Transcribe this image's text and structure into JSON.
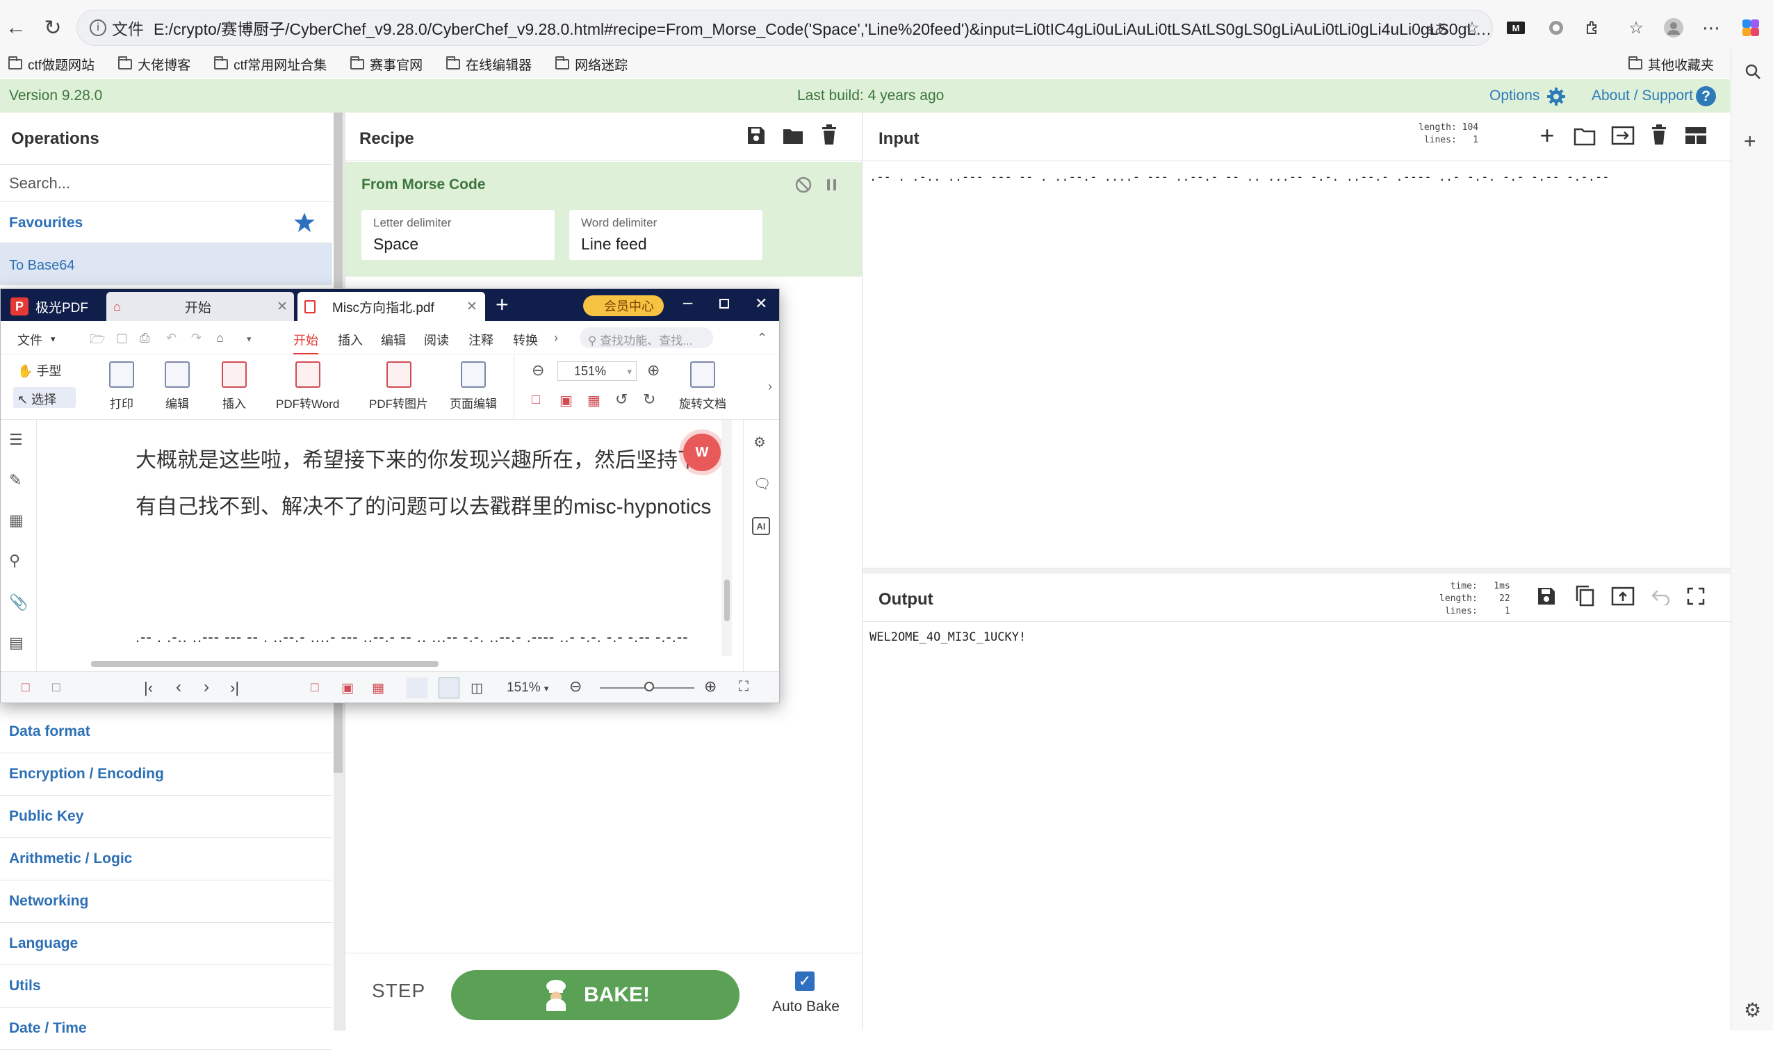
{
  "browser": {
    "file_label": "文件",
    "url": "E:/crypto/赛博厨子/CyberChef_v9.28.0/CyberChef_v9.28.0.html#recipe=From_Morse_Code('Space','Line%20feed')&input=Li0tIC4gLi0uLiAuLi0tLSAtLS0gLS0gLiAuLi0tLi0gLi4uLi0gLS0gLi0tLi0gLS0gLi4gLi4uLS0gLS4uLSAtLi0uIC4uLS0tLSAuLi4uLi4tLS0uLSAtLSAuLi4uLS4uLS0gLS4uLS4gLS4uLSAtLi0tLiAtLi0tIC0uLS0t...",
    "bookmarks": [
      "ctf做题网站",
      "大佬博客",
      "ctf常用网址合集",
      "赛事官网",
      "在线编辑器",
      "网络迷踪"
    ],
    "other_bookmarks": "其他收藏夹"
  },
  "banner": {
    "version": "Version 9.28.0",
    "last_build": "Last build: 4 years ago",
    "options": "Options",
    "about": "About / Support"
  },
  "operations": {
    "title": "Operations",
    "search_placeholder": "Search...",
    "favourites": "Favourites",
    "first_item": "To Base64",
    "categories": [
      "Data format",
      "Encryption / Encoding",
      "Public Key",
      "Arithmetic / Logic",
      "Networking",
      "Language",
      "Utils",
      "Date / Time"
    ]
  },
  "recipe": {
    "title": "Recipe",
    "operation": "From Morse Code",
    "args": [
      {
        "label": "Letter delimiter",
        "value": "Space"
      },
      {
        "label": "Word delimiter",
        "value": "Line feed"
      }
    ],
    "step": "STEP",
    "bake": "BAKE!",
    "auto_bake": "Auto Bake"
  },
  "input": {
    "title": "Input",
    "stats": "length: 104\n lines:   1",
    "text": ".-- . .-.. ..--- --- -- . ..--.- ....- --- ..--.- -- .. ...-- -.-. ..--.- .---- ..- -.-. -.- -.-- -.-.--"
  },
  "output": {
    "title": "Output",
    "stats": "  time:   1ms\nlength:    22\n lines:     1",
    "text": "WEL2OME_4O_MI3C_1UCKY!"
  },
  "pdf": {
    "app_name": "极光PDF",
    "tab_start": "开始",
    "tab_file": "Misc方向指北.pdf",
    "vip": "会员中心",
    "menu": [
      "文件",
      "开始",
      "插入",
      "编辑",
      "阅读",
      "注释",
      "转换"
    ],
    "search_placeholder": "查找功能、查找...",
    "tools_left": [
      "手型",
      "选择"
    ],
    "tools": [
      "打印",
      "编辑",
      "插入",
      "PDF转Word",
      "PDF转图片",
      "页面编辑"
    ],
    "zoom": "151%",
    "rotate": "旋转文档",
    "line1": "大概就是这些啦，希望接下来的你发现兴趣所在，然后坚持下",
    "line2": "有自己找不到、解决不了的问题可以去戳群里的misc-hypnotics",
    "morse": ".-- . .-.. ..--- --- -- . ..--.- ....- --- ..--.- -- .. ...-- -.-. ..--.- .---- ..- -.-. -.- -.-- -.-.--",
    "status_zoom": "151%"
  }
}
